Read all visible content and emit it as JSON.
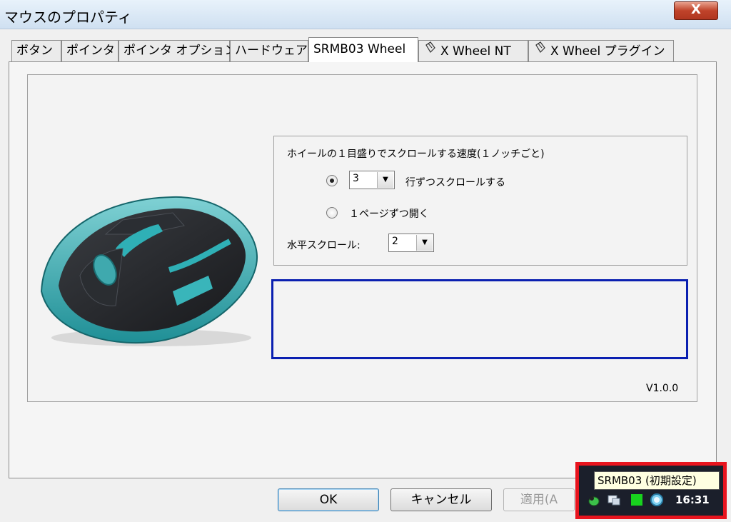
{
  "window": {
    "title": "マウスのプロパティ",
    "close_label": "X"
  },
  "tabs": [
    {
      "label": "ボタン"
    },
    {
      "label": "ポインタ"
    },
    {
      "label": "ポインタ オプション"
    },
    {
      "label": "ハードウェア"
    },
    {
      "label": "SRMB03 Wheel"
    },
    {
      "label": "X Wheel NT"
    },
    {
      "label": "X Wheel プラグイン"
    }
  ],
  "wheel": {
    "group_label": "ホイールの１目盛りでスクロールする速度(１ノッチごと)",
    "lines_value": "3",
    "lines_suffix": "行ずつスクロールする",
    "page_label": "１ページずつ開く",
    "horizontal_label": "水平スクロール:",
    "horizontal_value": "2",
    "lines_selected": true
  },
  "version": "V1.0.0",
  "buttons": {
    "ok": "OK",
    "cancel": "キャンセル",
    "apply": "適用(A"
  },
  "tray": {
    "tooltip": "SRMB03 (初期設定)",
    "clock": "16:31"
  }
}
